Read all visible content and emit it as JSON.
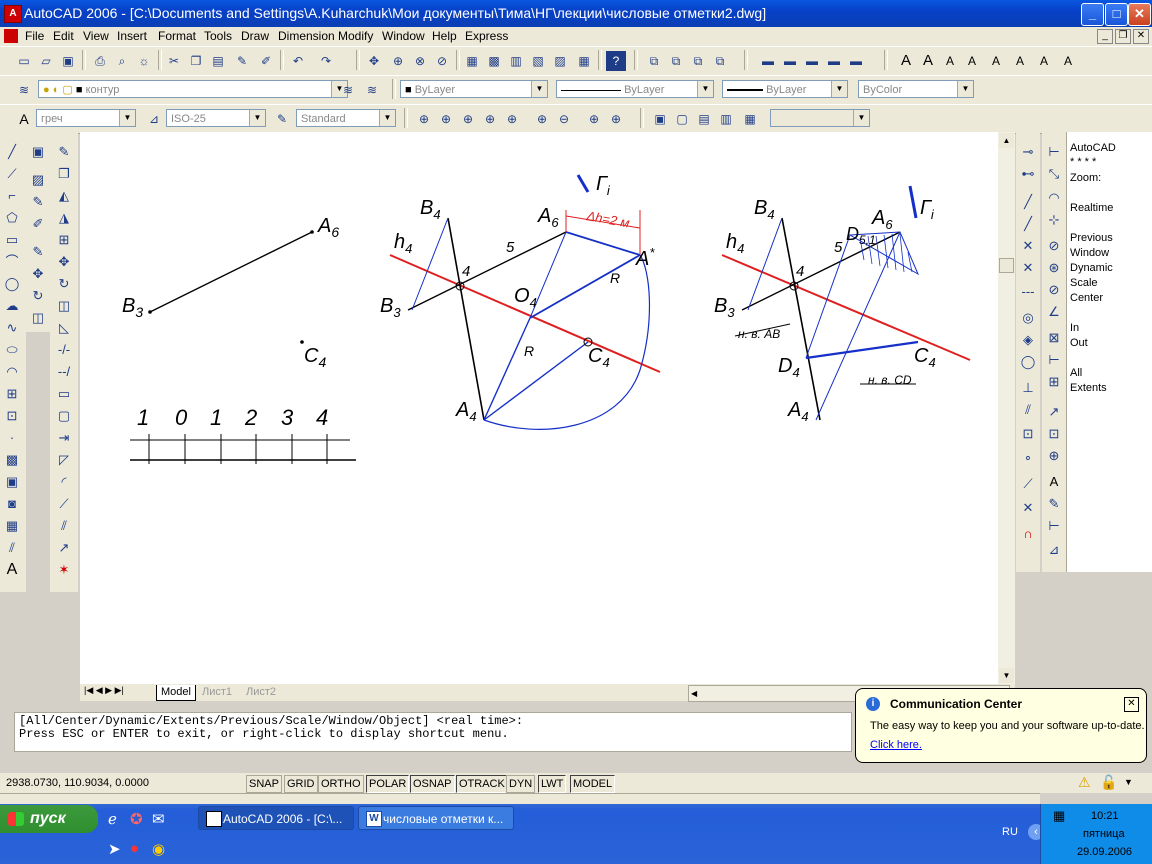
{
  "window": {
    "title": "AutoCAD 2006 - [C:\\Documents and Settings\\A.Kuharchuk\\Мои документы\\Тима\\НГ\\лекции\\числовые отметки2.dwg]"
  },
  "menu": [
    "File",
    "Edit",
    "View",
    "Insert",
    "Format",
    "Tools",
    "Draw",
    "Dimension",
    "Modify",
    "Window",
    "Help",
    "Express"
  ],
  "layers": {
    "layer_name": "контур",
    "color": "ByLayer",
    "linetype": "ByLayer",
    "lineweight": "ByLayer",
    "plotstyle": "ByColor"
  },
  "styles": {
    "text_style": "греч",
    "dim_style": "ISO-25",
    "table_style": "Standard"
  },
  "drawing": {
    "left_labels": {
      "a6": "A",
      "a6_sub": "6",
      "b3": "B",
      "b3_sub": "3",
      "c4": "C",
      "c4_sub": "4"
    },
    "scale_labels": [
      "1",
      "0",
      "1",
      "2",
      "3",
      "4"
    ],
    "mid": {
      "gamma": "Г",
      "gamma_sub": "i",
      "b4": "B",
      "b4_sub": "4",
      "a6": "A",
      "a6_sub": "6",
      "h4": "h",
      "h4_sub": "4",
      "five": "5",
      "four": "4",
      "dh": "Δh=2 м",
      "a_star": "A",
      "a_star_sup": "*",
      "r1": "R",
      "o4": "O",
      "o4_sub": "4",
      "b3": "B",
      "b3_sub": "3",
      "r2": "R",
      "c4": "C",
      "c4_sub": "4",
      "a4": "A",
      "a4_sub": "4"
    },
    "right": {
      "b4": "B",
      "b4_sub": "4",
      "a6": "A",
      "a6_sub": "6",
      "gamma": "Г",
      "gamma_sub": "i",
      "d51": "D",
      "d51_sub": "5,1",
      "h4": "h",
      "h4_sub": "4",
      "five": "5",
      "four": "4",
      "b3": "B",
      "b3_sub": "3",
      "nab": "н. в. АВ",
      "d4": "D",
      "d4_sub": "4",
      "c4": "C",
      "c4_sub": "4",
      "ncd": "н. в. СD",
      "a4": "A",
      "a4_sub": "4"
    }
  },
  "layout_tabs": [
    "Model",
    "Лист1",
    "Лист2"
  ],
  "panel": {
    "lines": [
      "AutoCAD",
      "* * * *",
      "Zoom:",
      "Realtime",
      "Previous",
      "Window",
      "Dynamic",
      "Scale",
      "Center",
      "In",
      "Out",
      "All",
      "Extents"
    ]
  },
  "command": {
    "line1": "[All/Center/Dynamic/Extents/Previous/Scale/Window/Object] <real time>:",
    "line2": "Press ESC or ENTER to exit, or right-click to display shortcut menu."
  },
  "status": {
    "coords": "2938.0730, 110.9034, 0.0000",
    "buttons": [
      "SNAP",
      "GRID",
      "ORTHO",
      "POLAR",
      "OSNAP",
      "OTRACK",
      "DYN",
      "LWT",
      "MODEL"
    ]
  },
  "balloon": {
    "title": "Communication Center",
    "text": "The easy way to keep you and your software up-to-date.",
    "link": "Click here."
  },
  "taskbar": {
    "start": "пуск",
    "tasks": [
      "AutoCAD 2006 - [C:\\...",
      "числовые отметки к..."
    ],
    "lang": "RU",
    "time": "10:21",
    "day": "пятница",
    "date": "29.09.2006"
  }
}
